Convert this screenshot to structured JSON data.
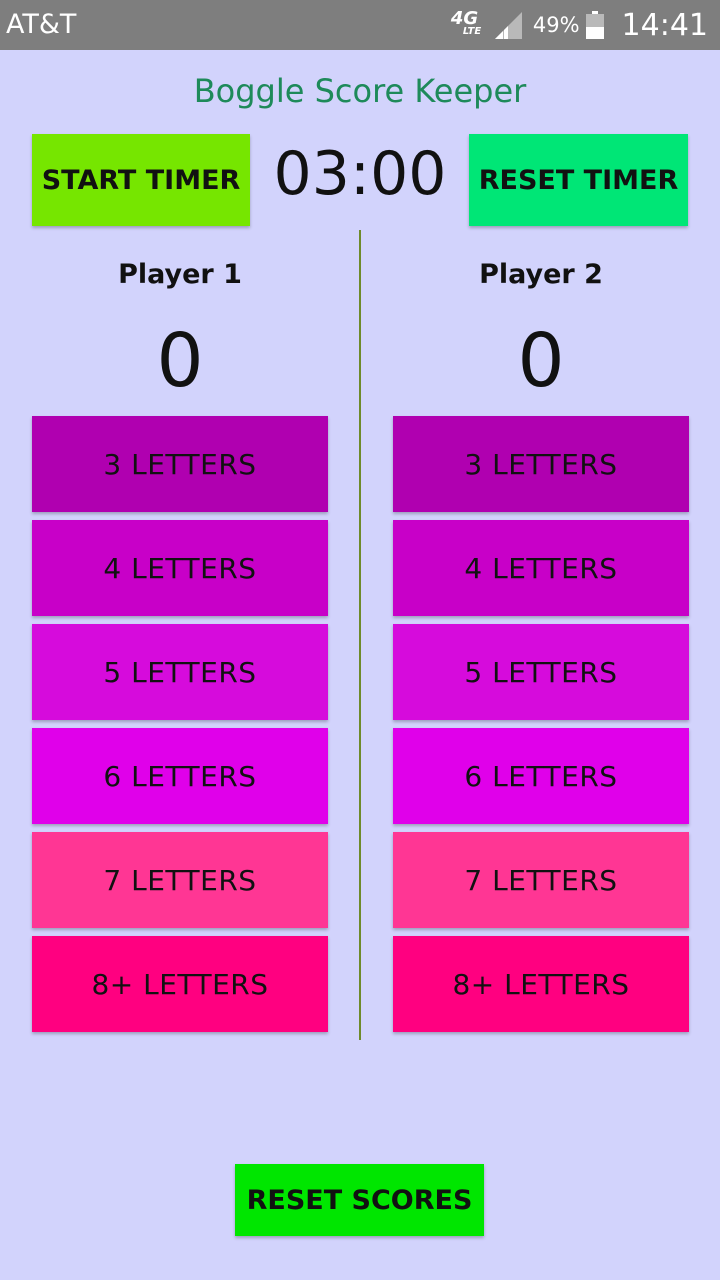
{
  "status_bar": {
    "carrier": "AT&T",
    "network": "4G",
    "network_sub": "LTE",
    "signal_icon": "signal-strength-icon",
    "battery_percent": "49%",
    "battery_level": 0.49,
    "time": "14:41"
  },
  "app": {
    "title": "Boggle Score Keeper"
  },
  "timer": {
    "start_label": "START TIMER",
    "display": "03:00",
    "reset_label": "RESET TIMER"
  },
  "players": [
    {
      "name": "Player 1",
      "score": "0",
      "buttons": [
        "3 LETTERS",
        "4 LETTERS",
        "5 LETTERS",
        "6 LETTERS",
        "7 LETTERS",
        "8+ LETTERS"
      ]
    },
    {
      "name": "Player 2",
      "score": "0",
      "buttons": [
        "3 LETTERS",
        "4 LETTERS",
        "5 LETTERS",
        "6 LETTERS",
        "7 LETTERS",
        "8+ LETTERS"
      ]
    }
  ],
  "reset_scores_label": "RESET SCORES",
  "colors": {
    "background": "#d2d3fc",
    "status_bar": "#7e7e7e",
    "title": "#1e8a5a",
    "start_timer": "#76e600",
    "reset_timer": "#00e676",
    "reset_scores": "#00e600",
    "divider": "#6e8a2a",
    "letter_buttons": [
      "#b000b0",
      "#c800c8",
      "#d60bdc",
      "#e000ea",
      "#ff3694",
      "#ff0080"
    ]
  }
}
